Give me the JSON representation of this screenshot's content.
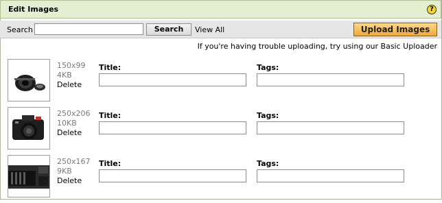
{
  "header": {
    "title": "Edit Images",
    "help_glyph": "?"
  },
  "toolbar": {
    "search_label": "Search",
    "search_value": "",
    "search_button": "Search",
    "view_all": "View All",
    "upload_button": "Upload Images"
  },
  "notice": "If you're having trouble uploading, try using our Basic Uploader",
  "images": [
    {
      "dims": "150x99",
      "size": "4KB",
      "delete": "Delete",
      "title_label": "Title:",
      "tags_label": "Tags:",
      "title_value": "",
      "tags_value": "",
      "thumb_icon": "camera-lens-icon"
    },
    {
      "dims": "250x206",
      "size": "10KB",
      "delete": "Delete",
      "title_label": "Title:",
      "tags_label": "Tags:",
      "title_value": "",
      "tags_value": "",
      "thumb_icon": "dslr-camera-icon"
    },
    {
      "dims": "250x167",
      "size": "9KB",
      "delete": "Delete",
      "title_label": "Title:",
      "tags_label": "Tags:",
      "title_value": "",
      "tags_value": "",
      "thumb_icon": "camera-closeup-icon"
    }
  ],
  "colors": {
    "header_bg": "#e4efd1",
    "toolbar_bg": "#e6e6e6",
    "upload_bg": "#f0a93a"
  }
}
